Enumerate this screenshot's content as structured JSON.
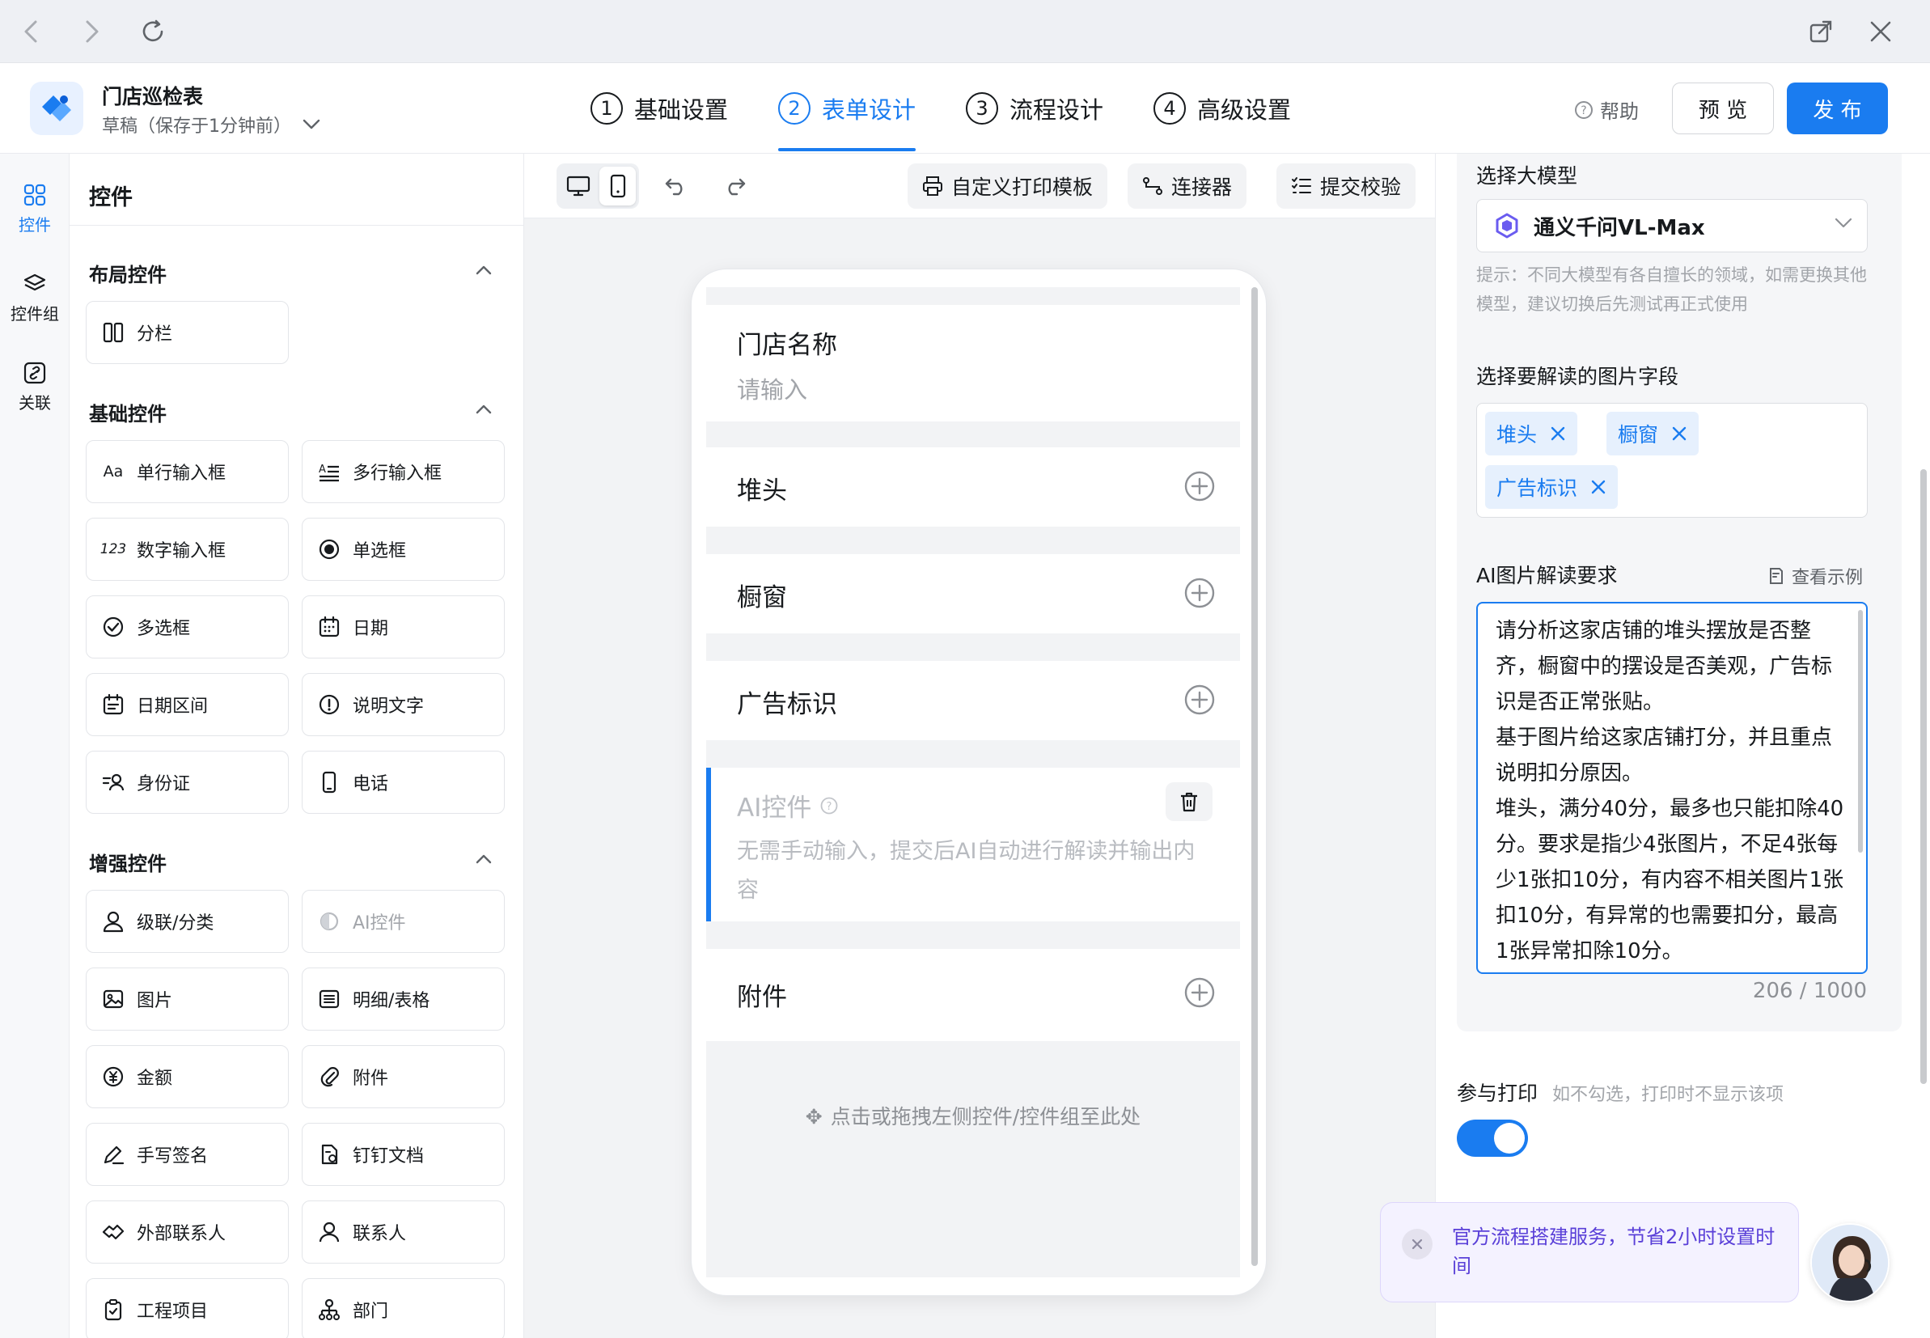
{
  "app": {
    "title": "门店巡检表",
    "status": "草稿（保存于1分钟前）"
  },
  "steps": [
    {
      "num": "1",
      "label": "基础设置"
    },
    {
      "num": "2",
      "label": "表单设计"
    },
    {
      "num": "3",
      "label": "流程设计"
    },
    {
      "num": "4",
      "label": "高级设置"
    }
  ],
  "header": {
    "help": "帮助",
    "preview": "预 览",
    "publish": "发 布"
  },
  "rail": [
    {
      "label": "控件"
    },
    {
      "label": "控件组"
    },
    {
      "label": "关联"
    }
  ],
  "panel": {
    "title": "控件",
    "groups": [
      {
        "title": "布局控件",
        "items": [
          {
            "label": "分栏",
            "icon": "columns-icon"
          }
        ]
      },
      {
        "title": "基础控件",
        "items": [
          {
            "label": "单行输入框",
            "icon": "text-input-icon",
            "glyph": "Aa"
          },
          {
            "label": "多行输入框",
            "icon": "textarea-icon"
          },
          {
            "label": "数字输入框",
            "icon": "number-input-icon",
            "glyph": "123"
          },
          {
            "label": "单选框",
            "icon": "radio-icon"
          },
          {
            "label": "多选框",
            "icon": "checkbox-icon"
          },
          {
            "label": "日期",
            "icon": "calendar-icon"
          },
          {
            "label": "日期区间",
            "icon": "date-range-icon"
          },
          {
            "label": "说明文字",
            "icon": "info-icon"
          },
          {
            "label": "身份证",
            "icon": "id-card-icon"
          },
          {
            "label": "电话",
            "icon": "phone-icon"
          }
        ]
      },
      {
        "title": "增强控件",
        "items": [
          {
            "label": "级联/分类",
            "icon": "cascade-icon"
          },
          {
            "label": "AI控件",
            "icon": "ai-icon"
          },
          {
            "label": "图片",
            "icon": "image-icon"
          },
          {
            "label": "明细/表格",
            "icon": "table-icon"
          },
          {
            "label": "金额",
            "icon": "money-icon"
          },
          {
            "label": "附件",
            "icon": "paperclip-icon"
          },
          {
            "label": "手写签名",
            "icon": "signature-icon"
          },
          {
            "label": "钉钉文档",
            "icon": "document-icon"
          },
          {
            "label": "外部联系人",
            "icon": "handshake-icon"
          },
          {
            "label": "联系人",
            "icon": "contact-icon"
          },
          {
            "label": "工程项目",
            "icon": "clipboard-icon"
          },
          {
            "label": "部门",
            "icon": "department-icon"
          }
        ]
      }
    ]
  },
  "toolbar": {
    "print_template": "自定义打印模板",
    "connector": "连接器",
    "submit_check": "提交校验"
  },
  "form": {
    "fields": [
      {
        "label": "门店名称",
        "placeholder": "请输入"
      },
      {
        "label": "堆头"
      },
      {
        "label": "橱窗"
      },
      {
        "label": "广告标识"
      },
      {
        "label": "AI控件",
        "placeholder": "无需手动输入，提交后AI自动进行解读并输出内容"
      },
      {
        "label": "附件"
      }
    ],
    "drop_hint": "点击或拖拽左侧控件/控件组至此处"
  },
  "props": {
    "model_label": "选择大模型",
    "model_value": "通义千问VL-Max",
    "model_hint": "提示：不同大模型有各自擅长的领域，如需更换其他模型，建议切换后先测试再正式使用",
    "image_field_label": "选择要解读的图片字段",
    "image_tags": [
      "堆头",
      "橱窗",
      "广告标识"
    ],
    "prompt_label": "AI图片解读要求",
    "example_link": "查看示例",
    "prompt_lines": [
      "请分析这家店铺的堆头摆放是否整齐，橱窗中的摆设是否美观，广告标识是否正常张贴。",
      "基于图片给这家店铺打分，并且重点说明扣分原因。",
      "堆头，满分40分，最多也只能扣除40分。要求是指少4张图片，不足4张每少1张扣10分，有内容不相关图片1张扣10分，有异常的也需要扣分，最高1张异常扣除10分。"
    ],
    "counter": "206 / 1000",
    "print_label": "参与打印",
    "print_hint": "如不勾选，打印时不显示该项",
    "print_enabled": true
  },
  "promo": {
    "text": "官方流程搭建服务，节省2小时设置时间"
  },
  "colors": {
    "accent": "#1a7cf0",
    "promo_text": "#5a40d8"
  }
}
